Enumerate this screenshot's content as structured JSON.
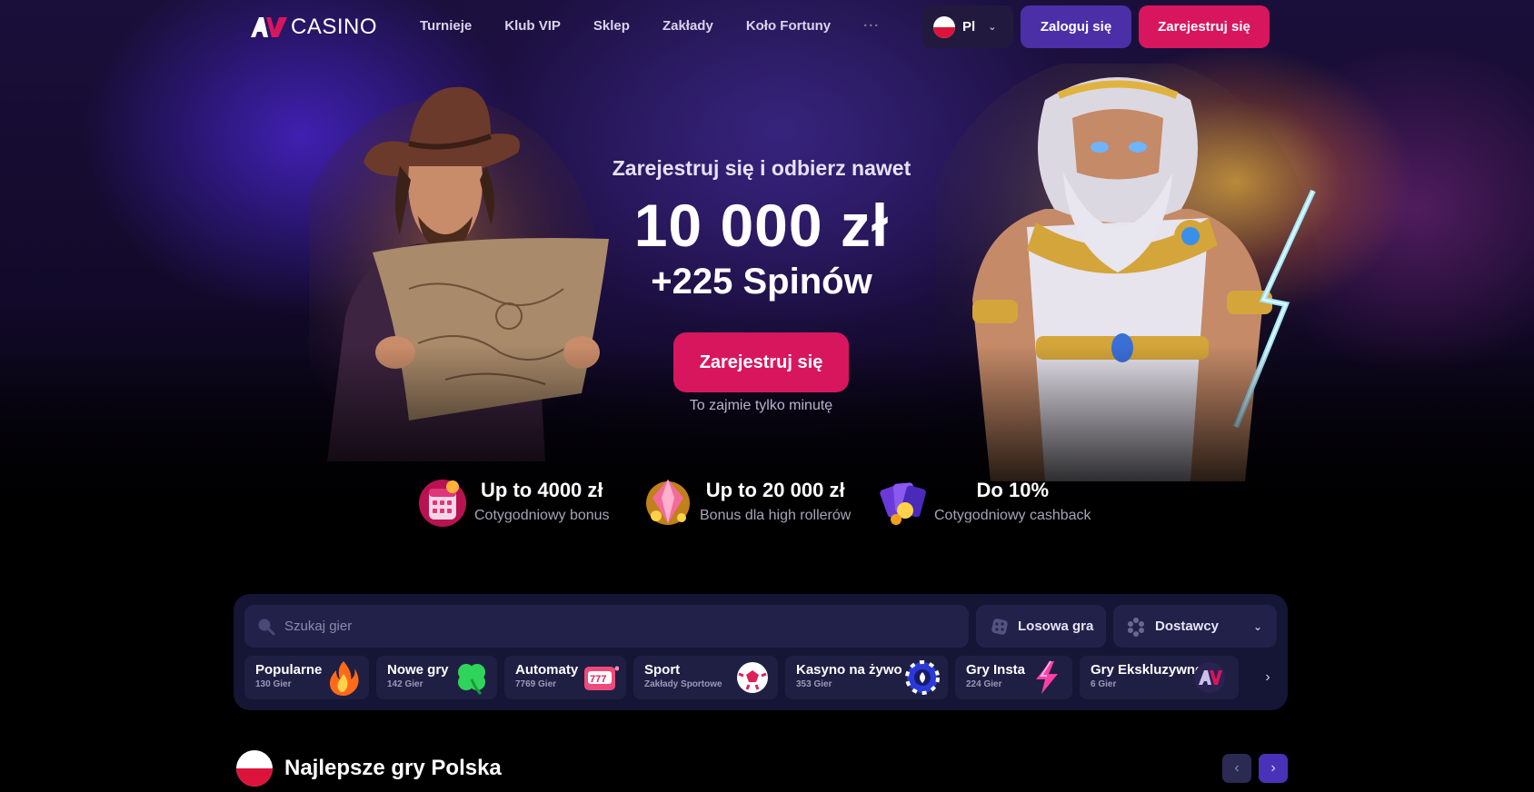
{
  "nav": {
    "logo_text": "CASINO",
    "links": [
      "Turnieje",
      "Klub VIP",
      "Sklep",
      "Zakłady",
      "Koło Fortuny"
    ],
    "more_label": "···",
    "lang_label": "Pl",
    "login_label": "Zaloguj się",
    "register_label": "Zarejestruj się"
  },
  "hero": {
    "subtitle": "Zarejestruj się i odbierz nawet",
    "amount": "10 000 zł",
    "spins": "+225 Spinów",
    "cta_label": "Zarejestruj się",
    "note": "To zajmie tylko minutę"
  },
  "perks": [
    {
      "title": "Up to 4000 zł",
      "desc": "Cotygodniowy bonus",
      "icon": "calendar-icon"
    },
    {
      "title": "Up to 20 000 zł",
      "desc": "Bonus dla high rollerów",
      "icon": "gem-icon"
    },
    {
      "title": "Do 10%",
      "desc": "Cotygodniowy cashback",
      "icon": "cards-icon"
    }
  ],
  "games": {
    "search_placeholder": "Szukaj gier",
    "random_label": "Losowa gra",
    "providers_label": "Dostawcy",
    "categories": [
      {
        "name": "Popularne",
        "count": "130 Gier",
        "icon": "fire-icon"
      },
      {
        "name": "Nowe gry",
        "count": "142 Gier",
        "icon": "clover-icon"
      },
      {
        "name": "Automaty",
        "count": "7769 Gier",
        "icon": "slot-machine-icon"
      },
      {
        "name": "Sport",
        "count": "Zakłady Sportowe",
        "icon": "soccer-ball-icon"
      },
      {
        "name": "Kasyno na żywo",
        "count": "353 Gier",
        "icon": "casino-chip-icon"
      },
      {
        "name": "Gry Insta",
        "count": "224 Gier",
        "icon": "lightning-icon"
      },
      {
        "name": "Gry Ekskluzywne",
        "count": "6 Gier",
        "icon": "av-logo-icon"
      }
    ]
  },
  "section": {
    "title": "Najlepsze gry Polska"
  },
  "colors": {
    "brand_pink": "#d8165e",
    "brand_purple": "#4b2fa6",
    "panel_bg": "#151535"
  }
}
